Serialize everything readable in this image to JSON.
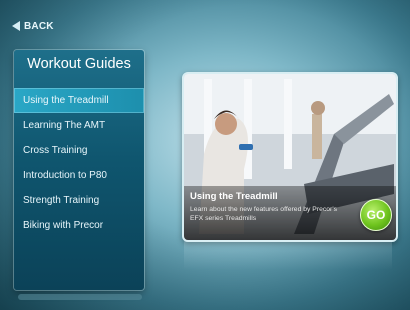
{
  "nav": {
    "back_label": "BACK"
  },
  "sidebar": {
    "title": "Workout Guides",
    "items": [
      {
        "label": "Using the Treadmill",
        "active": true
      },
      {
        "label": "Learning The AMT"
      },
      {
        "label": "Cross Training"
      },
      {
        "label": "Introduction to P80"
      },
      {
        "label": "Strength Training"
      },
      {
        "label": "Biking with Precor"
      }
    ]
  },
  "feature": {
    "title": "Using the Treadmill",
    "description": "Learn about the new features offered by Precor's EFX series Treadmills",
    "go_label": "GO"
  },
  "colors": {
    "accent": "#2aa7c6",
    "go_green": "#6fc41e",
    "panel": "#0f566f"
  }
}
